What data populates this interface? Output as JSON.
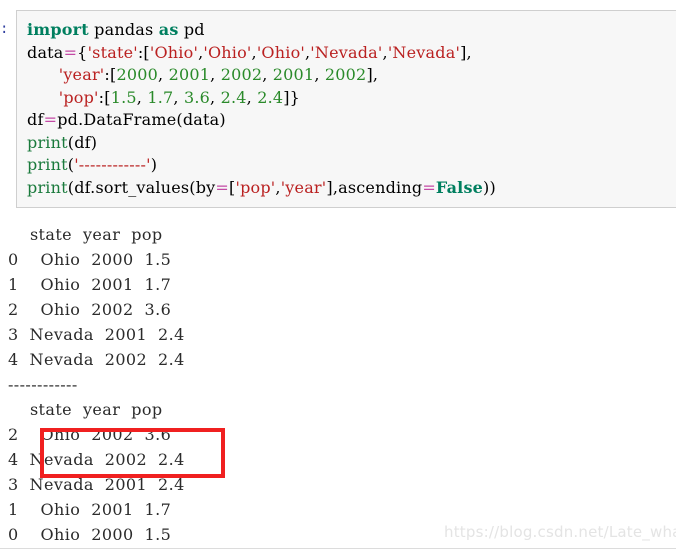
{
  "cell": {
    "prompt": ":",
    "code_lines": [
      [
        {
          "t": "import",
          "c": "kw"
        },
        {
          "t": " pandas ",
          "c": "plain"
        },
        {
          "t": "as",
          "c": "kw"
        },
        {
          "t": " pd",
          "c": "plain"
        }
      ],
      [
        {
          "t": "data",
          "c": "plain"
        },
        {
          "t": "=",
          "c": "op"
        },
        {
          "t": "{",
          "c": "plain"
        },
        {
          "t": "'state'",
          "c": "str"
        },
        {
          "t": ":[",
          "c": "plain"
        },
        {
          "t": "'Ohio'",
          "c": "str"
        },
        {
          "t": ",",
          "c": "plain"
        },
        {
          "t": "'Ohio'",
          "c": "str"
        },
        {
          "t": ",",
          "c": "plain"
        },
        {
          "t": "'Ohio'",
          "c": "str"
        },
        {
          "t": ",",
          "c": "plain"
        },
        {
          "t": "'Nevada'",
          "c": "str"
        },
        {
          "t": ",",
          "c": "plain"
        },
        {
          "t": "'Nevada'",
          "c": "str"
        },
        {
          "t": "],",
          "c": "plain"
        }
      ],
      [
        {
          "t": "      ",
          "c": "plain"
        },
        {
          "t": "'year'",
          "c": "str"
        },
        {
          "t": ":[",
          "c": "plain"
        },
        {
          "t": "2000",
          "c": "num"
        },
        {
          "t": ", ",
          "c": "plain"
        },
        {
          "t": "2001",
          "c": "num"
        },
        {
          "t": ", ",
          "c": "plain"
        },
        {
          "t": "2002",
          "c": "num"
        },
        {
          "t": ", ",
          "c": "plain"
        },
        {
          "t": "2001",
          "c": "num"
        },
        {
          "t": ", ",
          "c": "plain"
        },
        {
          "t": "2002",
          "c": "num"
        },
        {
          "t": "],",
          "c": "plain"
        }
      ],
      [
        {
          "t": "      ",
          "c": "plain"
        },
        {
          "t": "'pop'",
          "c": "str"
        },
        {
          "t": ":[",
          "c": "plain"
        },
        {
          "t": "1.5",
          "c": "num"
        },
        {
          "t": ", ",
          "c": "plain"
        },
        {
          "t": "1.7",
          "c": "num"
        },
        {
          "t": ", ",
          "c": "plain"
        },
        {
          "t": "3.6",
          "c": "num"
        },
        {
          "t": ", ",
          "c": "plain"
        },
        {
          "t": "2.4",
          "c": "num"
        },
        {
          "t": ", ",
          "c": "plain"
        },
        {
          "t": "2.4",
          "c": "num"
        },
        {
          "t": "]}",
          "c": "plain"
        }
      ],
      [
        {
          "t": "df",
          "c": "plain"
        },
        {
          "t": "=",
          "c": "op"
        },
        {
          "t": "pd.DataFrame(data)",
          "c": "plain"
        }
      ],
      [
        {
          "t": "print",
          "c": "fn"
        },
        {
          "t": "(df)",
          "c": "plain"
        }
      ],
      [
        {
          "t": "print",
          "c": "fn"
        },
        {
          "t": "(",
          "c": "plain"
        },
        {
          "t": "'------------'",
          "c": "str"
        },
        {
          "t": ")",
          "c": "plain"
        }
      ],
      [
        {
          "t": "print",
          "c": "fn"
        },
        {
          "t": "(df.sort_values(by",
          "c": "plain"
        },
        {
          "t": "=",
          "c": "op"
        },
        {
          "t": "[",
          "c": "plain"
        },
        {
          "t": "'pop'",
          "c": "str"
        },
        {
          "t": ",",
          "c": "plain"
        },
        {
          "t": "'year'",
          "c": "str"
        },
        {
          "t": "],ascending",
          "c": "plain"
        },
        {
          "t": "=",
          "c": "op"
        },
        {
          "t": "False",
          "c": "kw"
        },
        {
          "t": "))",
          "c": "plain"
        }
      ]
    ]
  },
  "output": {
    "lines": [
      "    state  year  pop",
      "0    Ohio  2000  1.5",
      "1    Ohio  2001  1.7",
      "2    Ohio  2002  3.6",
      "3  Nevada  2001  2.4",
      "4  Nevada  2002  2.4",
      "------------",
      "    state  year  pop",
      "2    Ohio  2002  3.6",
      "4  Nevada  2002  2.4",
      "3  Nevada  2001  2.4",
      "1    Ohio  2001  1.7",
      "0    Ohio  2000  1.5"
    ],
    "dataframe_original": {
      "columns": [
        "state",
        "year",
        "pop"
      ],
      "index": [
        "0",
        "1",
        "2",
        "3",
        "4"
      ],
      "rows": [
        [
          "Ohio",
          "2000",
          "1.5"
        ],
        [
          "Ohio",
          "2001",
          "1.7"
        ],
        [
          "Ohio",
          "2002",
          "3.6"
        ],
        [
          "Nevada",
          "2001",
          "2.4"
        ],
        [
          "Nevada",
          "2002",
          "2.4"
        ]
      ]
    },
    "separator": "------------",
    "dataframe_sorted": {
      "columns": [
        "state",
        "year",
        "pop"
      ],
      "index": [
        "2",
        "4",
        "3",
        "1",
        "0"
      ],
      "rows": [
        [
          "Ohio",
          "2002",
          "3.6"
        ],
        [
          "Nevada",
          "2002",
          "2.4"
        ],
        [
          "Nevada",
          "2001",
          "2.4"
        ],
        [
          "Ohio",
          "2001",
          "1.7"
        ],
        [
          "Ohio",
          "2000",
          "1.5"
        ]
      ]
    }
  },
  "annotation": {
    "highlight_color": "#f02020",
    "highlighted_rows": [
      "4  Nevada  2002  2.4",
      "3  Nevada  2001  2.4"
    ]
  },
  "watermark": {
    "text": "https://blog.csdn.net/Late_whale"
  },
  "colors": {
    "cell_background": "#f7f7f7",
    "cell_border": "#cfcfcf",
    "keyword": "#007f5f",
    "builtin": "#1a7a3c",
    "string": "#ba2121",
    "number": "#2a8a2a",
    "operator": "#c34aa5",
    "prompt": "#303f9f",
    "output_text": "#2b2b2b",
    "watermark": "#e4e4e4"
  }
}
